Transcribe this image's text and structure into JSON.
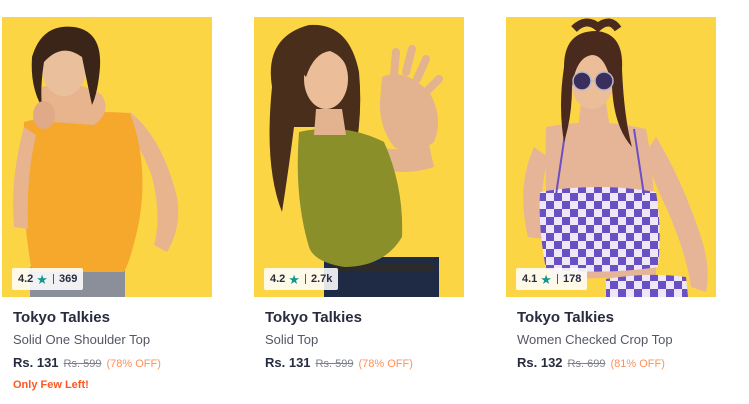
{
  "colors": {
    "image_background": "#fcd545",
    "rating_star": "#14958f",
    "discount": "#ff905a",
    "stock_alert": "#ff5722",
    "text_primary": "#282c3f",
    "text_secondary": "#535766"
  },
  "products": [
    {
      "image_icon": "model-photo-orange-one-shoulder-top",
      "rating": "4.2",
      "rating_count": "369",
      "brand": "Tokyo Talkies",
      "name": "Solid One Shoulder Top",
      "price": "Rs. 131",
      "mrp": "Rs. 599",
      "discount": "(78% OFF)",
      "stock_note": "Only Few Left!"
    },
    {
      "image_icon": "model-photo-olive-solid-top",
      "rating": "4.2",
      "rating_count": "2.7k",
      "brand": "Tokyo Talkies",
      "name": "Solid Top",
      "price": "Rs. 131",
      "mrp": "Rs. 599",
      "discount": "(78% OFF)"
    },
    {
      "image_icon": "model-photo-purple-checked-crop-top",
      "rating": "4.1",
      "rating_count": "178",
      "brand": "Tokyo Talkies",
      "name": "Women Checked Crop Top",
      "price": "Rs. 132",
      "mrp": "Rs. 699",
      "discount": "(81% OFF)"
    }
  ]
}
